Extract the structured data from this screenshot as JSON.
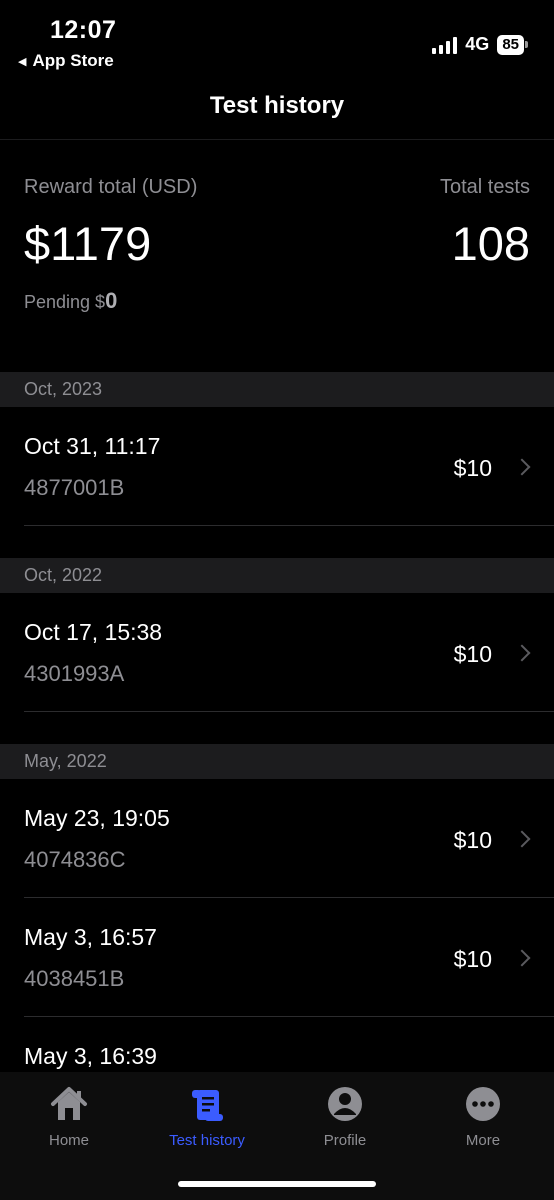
{
  "status_bar": {
    "time": "12:07",
    "back_app": "App Store",
    "network": "4G",
    "battery": "85"
  },
  "nav": {
    "title": "Test history"
  },
  "summary": {
    "reward_label": "Reward total (USD)",
    "reward_value": "$1179",
    "tests_label": "Total tests",
    "tests_value": "108",
    "pending_label": "Pending $",
    "pending_value": "0"
  },
  "sections": [
    {
      "header": "Oct, 2023",
      "rows": [
        {
          "date": "Oct 31, 11:17",
          "id": "4877001B",
          "amount": "$10"
        }
      ]
    },
    {
      "header": "Oct, 2022",
      "rows": [
        {
          "date": "Oct 17, 15:38",
          "id": "4301993A",
          "amount": "$10"
        }
      ]
    },
    {
      "header": "May, 2022",
      "rows": [
        {
          "date": "May 23, 19:05",
          "id": "4074836C",
          "amount": "$10"
        },
        {
          "date": "May 3, 16:57",
          "id": "4038451B",
          "amount": "$10"
        },
        {
          "date": "May 3, 16:39",
          "id": "",
          "amount": ""
        }
      ]
    }
  ],
  "tab_bar": {
    "items": [
      {
        "label": "Home",
        "icon": "home-icon"
      },
      {
        "label": "Test history",
        "icon": "scroll-icon",
        "active": true
      },
      {
        "label": "Profile",
        "icon": "person-icon"
      },
      {
        "label": "More",
        "icon": "more-icon"
      }
    ],
    "active_color": "#3b5cff",
    "inactive_color": "#8e8e93"
  }
}
